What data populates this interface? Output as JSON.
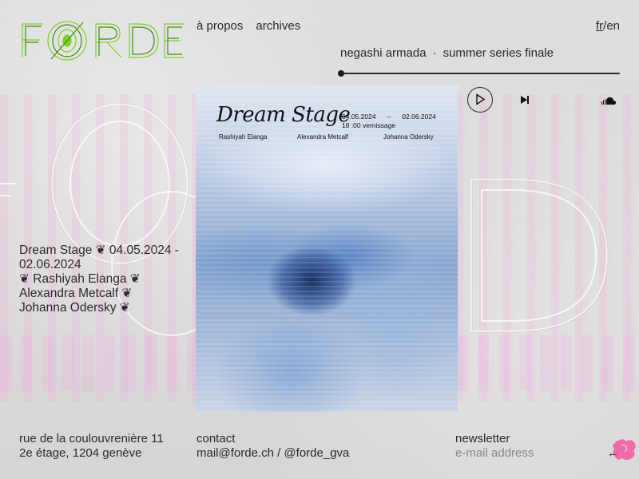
{
  "brand": {
    "logo_text": "FØRDE",
    "accent": "#7fcf2a",
    "accent_dark": "#3f8a12",
    "blob_color": "#f06aa8"
  },
  "nav": {
    "items": [
      {
        "label": "à propos"
      },
      {
        "label": "archives"
      }
    ]
  },
  "lang": {
    "fr": "fr",
    "sep": "/",
    "en": "en"
  },
  "player": {
    "artist": "negashi armada",
    "separator": "·",
    "track": "summer series finale",
    "progress": 0.0,
    "icons": {
      "prev": "skip-previous-icon",
      "play": "play-icon",
      "next": "skip-next-icon",
      "service": "soundcloud-icon"
    }
  },
  "poster": {
    "title": "Dream Stage",
    "date_start": "04.05.2024",
    "date_sep": "–",
    "date_end": "02.06.2024",
    "vernissage": "18 :00 vernissage",
    "artists": [
      "Rashiyah Elanga",
      "Alexandra Metcalf",
      "Johanna Odersky"
    ]
  },
  "info": {
    "line1": "Dream Stage ❦ 04.05.2024 -",
    "line2": "02.06.2024",
    "line3": "❦ Rashiyah Elanga ❦",
    "line4": "Alexandra Metcalf ❦",
    "line5": "Johanna Odersky ❦"
  },
  "footer": {
    "address_line1": "rue de la coulouvrenière 11",
    "address_line2": "2e étage, 1204 genève",
    "contact_label": "contact",
    "contact_value": "mail@forde.ch / @forde_gva",
    "newsletter_label": "newsletter",
    "newsletter_placeholder": "e-mail address",
    "submit_icon": "arrow-left-icon",
    "submit_glyph": "←"
  }
}
